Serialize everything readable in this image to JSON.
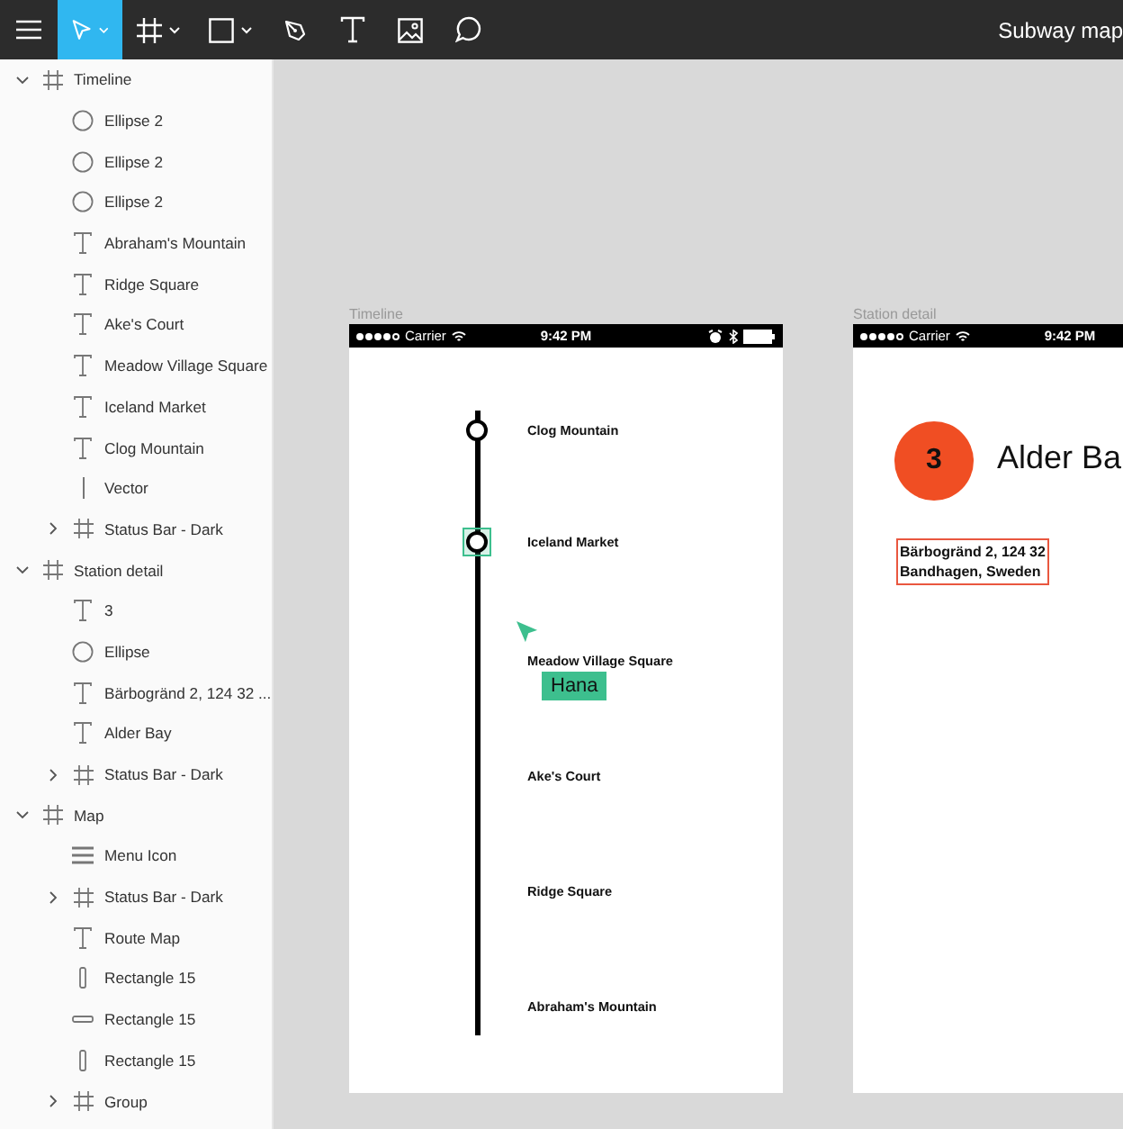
{
  "toolbar": {
    "tools": [
      {
        "kind": "menu",
        "selected": false,
        "dropdown": false
      },
      {
        "kind": "move",
        "selected": true,
        "dropdown": true
      },
      {
        "kind": "frame",
        "selected": false,
        "dropdown": true
      },
      {
        "kind": "rectangle",
        "selected": false,
        "dropdown": true
      },
      {
        "kind": "pen",
        "selected": false,
        "dropdown": false
      },
      {
        "kind": "text",
        "selected": false,
        "dropdown": false
      },
      {
        "kind": "image",
        "selected": false,
        "dropdown": false
      },
      {
        "kind": "comment",
        "selected": false,
        "dropdown": false
      }
    ],
    "document_title": "Subway map"
  },
  "layers": [
    {
      "name": "Timeline",
      "kind": "frame",
      "expanded": true,
      "children": [
        {
          "name": "Ellipse 2",
          "kind": "ellipse"
        },
        {
          "name": "Ellipse 2",
          "kind": "ellipse"
        },
        {
          "name": "Ellipse 2",
          "kind": "ellipse"
        },
        {
          "name": "Abraham's Mountain",
          "kind": "text"
        },
        {
          "name": "Ridge Square",
          "kind": "text"
        },
        {
          "name": "Ake's Court",
          "kind": "text"
        },
        {
          "name": "Meadow Village Square",
          "kind": "text"
        },
        {
          "name": "Iceland Market",
          "kind": "text"
        },
        {
          "name": "Clog Mountain",
          "kind": "text"
        },
        {
          "name": "Vector",
          "kind": "vector"
        },
        {
          "name": "Status Bar - Dark",
          "kind": "frame",
          "expanded": false
        }
      ]
    },
    {
      "name": "Station detail",
      "kind": "frame",
      "expanded": true,
      "children": [
        {
          "name": "3",
          "kind": "text"
        },
        {
          "name": "Ellipse",
          "kind": "ellipse"
        },
        {
          "name": "Bärbogränd 2, 124 32 ...",
          "kind": "text"
        },
        {
          "name": "Alder Bay",
          "kind": "text"
        },
        {
          "name": "Status Bar - Dark",
          "kind": "frame",
          "expanded": false
        }
      ]
    },
    {
      "name": "Map",
      "kind": "frame",
      "expanded": true,
      "children": [
        {
          "name": "Menu Icon",
          "kind": "menu"
        },
        {
          "name": "Status Bar - Dark",
          "kind": "frame",
          "expanded": false
        },
        {
          "name": "Route Map",
          "kind": "text"
        },
        {
          "name": "Rectangle 15",
          "kind": "rect-vertical"
        },
        {
          "name": "Rectangle 15",
          "kind": "rect-horizontal"
        },
        {
          "name": "Rectangle 15",
          "kind": "rect-vertical"
        },
        {
          "name": "Group",
          "kind": "frame",
          "expanded": false
        }
      ]
    }
  ],
  "canvas": {
    "artboards": [
      {
        "kind": "timeline",
        "title": "Timeline",
        "status_bar": {
          "carrier": "Carrier",
          "time": "9:42 PM"
        },
        "stations": [
          {
            "name": "Clog Mountain",
            "marker": true,
            "selected": false
          },
          {
            "name": "Iceland Market",
            "marker": true,
            "selected": true
          },
          {
            "name": "Meadow Village Square",
            "marker": false,
            "selected": false
          },
          {
            "name": "Ake's Court",
            "marker": false,
            "selected": false
          },
          {
            "name": "Ridge Square",
            "marker": false,
            "selected": false
          },
          {
            "name": "Abraham's Mountain",
            "marker": false,
            "selected": false
          }
        ]
      },
      {
        "kind": "detail",
        "title": "Station detail",
        "status_bar": {
          "carrier": "Carrier",
          "time": "9:42 PM"
        },
        "number": "3",
        "station": "Alder Ba",
        "address": {
          "lines": [
            "Bärbogränd 2, 124 32",
            "Bandhagen, Sweden"
          ],
          "selected": true
        }
      }
    ],
    "collaborators": [
      {
        "name": "Hana",
        "color": "#3dbf8e"
      }
    ]
  }
}
